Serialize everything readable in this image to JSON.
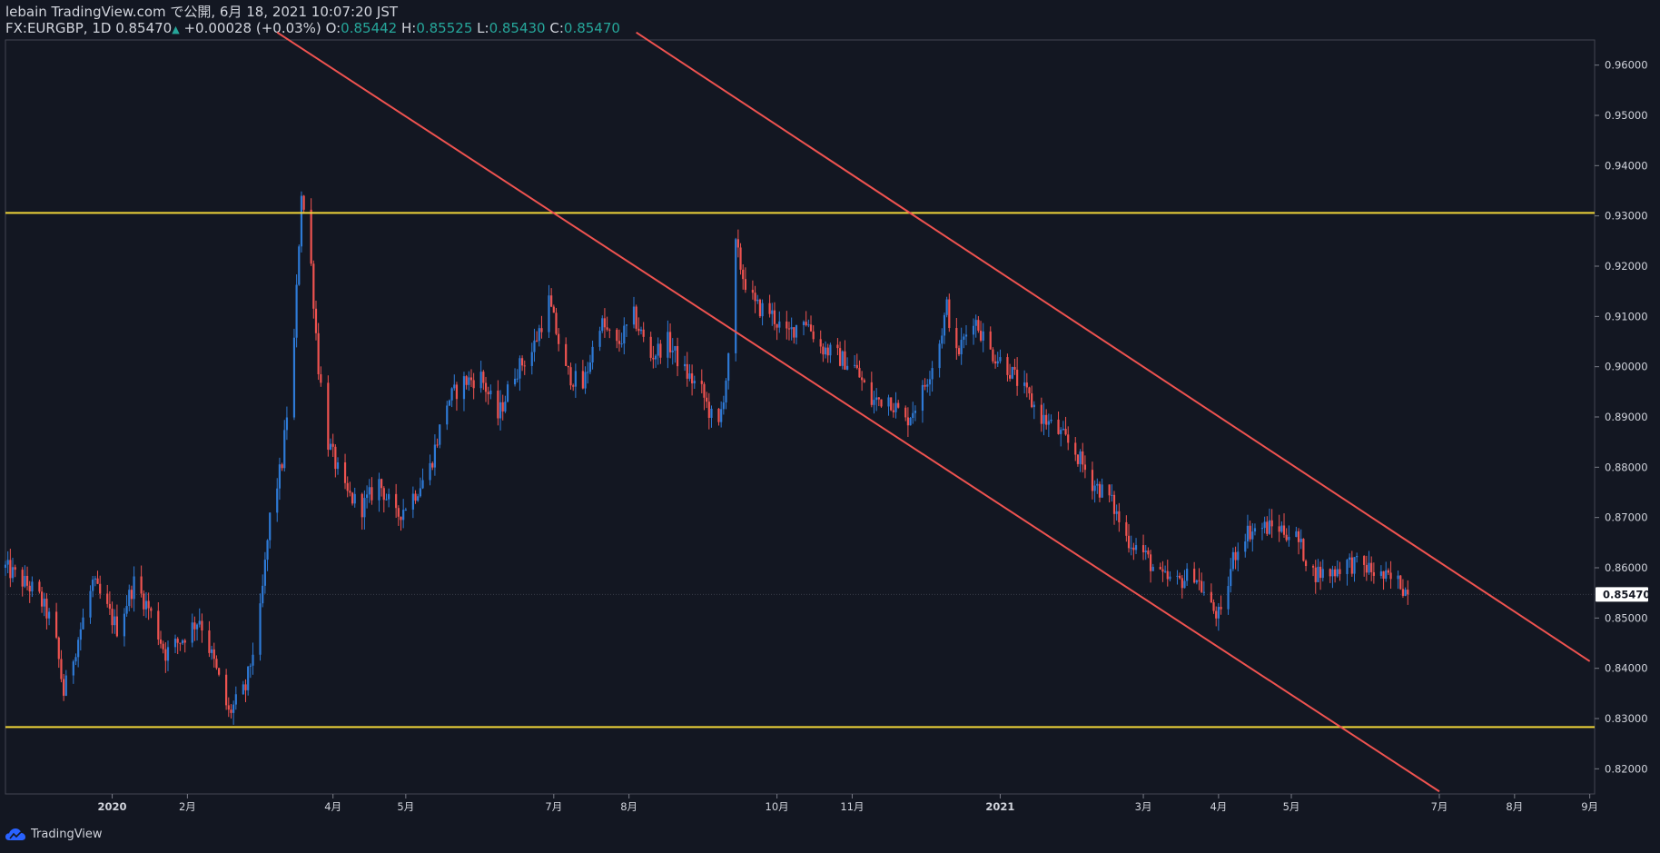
{
  "header": {
    "line1": "lebain TradingView.com で公開, 6月 18, 2021 10:07:20 JST",
    "symbol": "FX:EURGBP, 1D 0.85470",
    "change_arrow": "▲",
    "change": "+0.00028 (+0.03%)",
    "o_label": "O:",
    "o_value": "0.85442",
    "h_label": "H:",
    "h_value": "0.85525",
    "l_label": "L:",
    "l_value": "0.85430",
    "c_label": "C:",
    "c_value": "0.85470"
  },
  "footer": {
    "brand": "TradingView"
  },
  "colors": {
    "background": "#131722",
    "up": "#2e7ad6",
    "down": "#ef5350",
    "trendline": "#ef5350",
    "horizontal": "#f0d53a",
    "price_tag_bg": "#ffffff",
    "text": "#d1d4dc"
  },
  "chart_data": {
    "type": "candlestick",
    "symbol": "FX:EURGBP",
    "interval": "1D",
    "last_price": "0.85470",
    "ylim": [
      0.815,
      0.965
    ],
    "y_ticks": [
      "0.82000",
      "0.83000",
      "0.84000",
      "0.85000",
      "0.86000",
      "0.87000",
      "0.88000",
      "0.89000",
      "0.90000",
      "0.91000",
      "0.92000",
      "0.93000",
      "0.94000",
      "0.95000",
      "0.96000"
    ],
    "x_ticks": [
      {
        "label": "2020",
        "date": "2020-01-01",
        "bold": true
      },
      {
        "label": "2月",
        "date": "2020-02-01"
      },
      {
        "label": "4月",
        "date": "2020-04-01"
      },
      {
        "label": "5月",
        "date": "2020-05-01"
      },
      {
        "label": "7月",
        "date": "2020-07-01"
      },
      {
        "label": "8月",
        "date": "2020-08-01"
      },
      {
        "label": "10月",
        "date": "2020-10-01"
      },
      {
        "label": "11月",
        "date": "2020-11-01"
      },
      {
        "label": "2021",
        "date": "2021-01-01",
        "bold": true
      },
      {
        "label": "3月",
        "date": "2021-03-01"
      },
      {
        "label": "4月",
        "date": "2021-04-01"
      },
      {
        "label": "5月",
        "date": "2021-05-01"
      },
      {
        "label": "7月",
        "date": "2021-07-01"
      },
      {
        "label": "8月",
        "date": "2021-08-01"
      },
      {
        "label": "9月",
        "date": "2021-09-01"
      }
    ],
    "price_path": [
      [
        "2019-11-18",
        0.86
      ],
      [
        "2019-12-01",
        0.855
      ],
      [
        "2019-12-08",
        0.848
      ],
      [
        "2019-12-12",
        0.835
      ],
      [
        "2019-12-18",
        0.846
      ],
      [
        "2019-12-24",
        0.857
      ],
      [
        "2020-01-03",
        0.848
      ],
      [
        "2020-01-10",
        0.857
      ],
      [
        "2020-01-16",
        0.852
      ],
      [
        "2020-01-23",
        0.843
      ],
      [
        "2020-01-30",
        0.846
      ],
      [
        "2020-02-06",
        0.85
      ],
      [
        "2020-02-12",
        0.841
      ],
      [
        "2020-02-18",
        0.831
      ],
      [
        "2020-02-25",
        0.836
      ],
      [
        "2020-03-02",
        0.851
      ],
      [
        "2020-03-06",
        0.87
      ],
      [
        "2020-03-11",
        0.881
      ],
      [
        "2020-03-16",
        0.905
      ],
      [
        "2020-03-19",
        0.935
      ],
      [
        "2020-03-23",
        0.92
      ],
      [
        "2020-03-26",
        0.9
      ],
      [
        "2020-03-30",
        0.885
      ],
      [
        "2020-04-06",
        0.875
      ],
      [
        "2020-04-13",
        0.872
      ],
      [
        "2020-04-20",
        0.877
      ],
      [
        "2020-04-27",
        0.87
      ],
      [
        "2020-05-05",
        0.875
      ],
      [
        "2020-05-11",
        0.88
      ],
      [
        "2020-05-18",
        0.893
      ],
      [
        "2020-05-25",
        0.897
      ],
      [
        "2020-06-01",
        0.898
      ],
      [
        "2020-06-08",
        0.89
      ],
      [
        "2020-06-15",
        0.899
      ],
      [
        "2020-06-22",
        0.903
      ],
      [
        "2020-06-29",
        0.913
      ],
      [
        "2020-07-06",
        0.899
      ],
      [
        "2020-07-13",
        0.896
      ],
      [
        "2020-07-20",
        0.909
      ],
      [
        "2020-07-27",
        0.904
      ],
      [
        "2020-08-03",
        0.91
      ],
      [
        "2020-08-10",
        0.902
      ],
      [
        "2020-08-17",
        0.905
      ],
      [
        "2020-08-24",
        0.899
      ],
      [
        "2020-08-31",
        0.895
      ],
      [
        "2020-09-04",
        0.89
      ],
      [
        "2020-09-07",
        0.888
      ],
      [
        "2020-09-11",
        0.901
      ],
      [
        "2020-09-14",
        0.924
      ],
      [
        "2020-09-17",
        0.918
      ],
      [
        "2020-09-22",
        0.912
      ],
      [
        "2020-09-28",
        0.911
      ],
      [
        "2020-10-05",
        0.906
      ],
      [
        "2020-10-12",
        0.91
      ],
      [
        "2020-10-19",
        0.904
      ],
      [
        "2020-10-26",
        0.902
      ],
      [
        "2020-11-02",
        0.9
      ],
      [
        "2020-11-09",
        0.893
      ],
      [
        "2020-11-16",
        0.894
      ],
      [
        "2020-11-23",
        0.889
      ],
      [
        "2020-11-30",
        0.895
      ],
      [
        "2020-12-07",
        0.905
      ],
      [
        "2020-12-10",
        0.912
      ],
      [
        "2020-12-14",
        0.902
      ],
      [
        "2020-12-21",
        0.91
      ],
      [
        "2020-12-28",
        0.903
      ],
      [
        "2021-01-04",
        0.9
      ],
      [
        "2021-01-11",
        0.895
      ],
      [
        "2021-01-18",
        0.89
      ],
      [
        "2021-01-25",
        0.887
      ],
      [
        "2021-02-01",
        0.883
      ],
      [
        "2021-02-08",
        0.877
      ],
      [
        "2021-02-15",
        0.874
      ],
      [
        "2021-02-22",
        0.866
      ],
      [
        "2021-03-01",
        0.863
      ],
      [
        "2021-03-08",
        0.858
      ],
      [
        "2021-03-15",
        0.857
      ],
      [
        "2021-03-22",
        0.859
      ],
      [
        "2021-03-29",
        0.852
      ],
      [
        "2021-04-02",
        0.85
      ],
      [
        "2021-04-07",
        0.862
      ],
      [
        "2021-04-12",
        0.867
      ],
      [
        "2021-04-19",
        0.868
      ],
      [
        "2021-04-26",
        0.868
      ],
      [
        "2021-05-03",
        0.866
      ],
      [
        "2021-05-10",
        0.859
      ],
      [
        "2021-05-17",
        0.859
      ],
      [
        "2021-05-24",
        0.861
      ],
      [
        "2021-06-01",
        0.86
      ],
      [
        "2021-06-08",
        0.858
      ],
      [
        "2021-06-15",
        0.857
      ],
      [
        "2021-06-18",
        0.8547
      ]
    ],
    "horizontal_lines": [
      0.9306,
      0.8283
    ],
    "trend_lines": [
      {
        "from": [
          "2020-03-09",
          0.9665
        ],
        "to": [
          "2021-07-01",
          0.8155
        ]
      },
      {
        "from": [
          "2020-08-04",
          0.9665
        ],
        "to": [
          "2021-09-01",
          0.8414
        ]
      }
    ],
    "grid": false
  }
}
